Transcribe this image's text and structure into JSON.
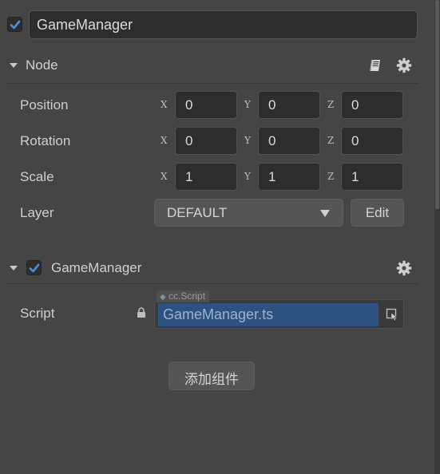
{
  "node": {
    "enabled": true,
    "name": "GameManager"
  },
  "node_section": {
    "title": "Node",
    "icons": [
      "book-icon",
      "gear-icon"
    ]
  },
  "transform": {
    "position": {
      "label": "Position",
      "x": "0",
      "y": "0",
      "z": "0"
    },
    "rotation": {
      "label": "Rotation",
      "x": "0",
      "y": "0",
      "z": "0"
    },
    "scale": {
      "label": "Scale",
      "x": "1",
      "y": "1",
      "z": "1"
    },
    "axis_labels": {
      "x": "X",
      "y": "Y",
      "z": "Z"
    }
  },
  "layer": {
    "label": "Layer",
    "selected": "DEFAULT",
    "edit_label": "Edit"
  },
  "component": {
    "enabled": true,
    "title": "GameManager",
    "script_label": "Script",
    "script_type": "cc.Script",
    "script_value": "GameManager.ts"
  },
  "add_component_label": "添加组件",
  "colors": {
    "background": "#454545",
    "checkbox_check": "#4a90e2",
    "script_value_bg": "#2d5282"
  }
}
